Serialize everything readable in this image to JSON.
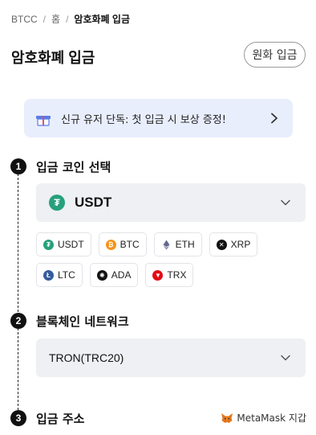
{
  "breadcrumb": {
    "items": [
      "BTCC",
      "홈",
      "암호화폐 입금"
    ]
  },
  "page": {
    "title": "암호화폐 입금",
    "fiat_button": "원화 입금"
  },
  "promo": {
    "text": "신규 유저 단독: 첫 입금 시 보상 증정!"
  },
  "steps": [
    {
      "number": "1",
      "title": "입금 코인 선택"
    },
    {
      "number": "2",
      "title": "블록체인 네트워크"
    },
    {
      "number": "3",
      "title": "입금 주소"
    }
  ],
  "coin_select": {
    "selected": "USDT",
    "icon": "usdt-icon"
  },
  "coin_chips": [
    {
      "label": "USDT",
      "icon": "usdt-icon",
      "color": "#26a17b"
    },
    {
      "label": "BTC",
      "icon": "btc-icon",
      "color": "#f7931a"
    },
    {
      "label": "ETH",
      "icon": "eth-icon",
      "color": "#62688f"
    },
    {
      "label": "XRP",
      "icon": "xrp-icon",
      "color": "#111111"
    },
    {
      "label": "LTC",
      "icon": "ltc-icon",
      "color": "#345d9d"
    },
    {
      "label": "ADA",
      "icon": "ada-icon",
      "color": "#111111"
    },
    {
      "label": "TRX",
      "icon": "trx-icon",
      "color": "#e50915"
    }
  ],
  "network_select": {
    "selected": "TRON(TRC20)"
  },
  "metamask": {
    "label": "MetaMask 지갑"
  },
  "colors": {
    "promo_bg": "#e9eefc",
    "select_bg": "#eef0f3",
    "accent": "#2f5de4"
  }
}
